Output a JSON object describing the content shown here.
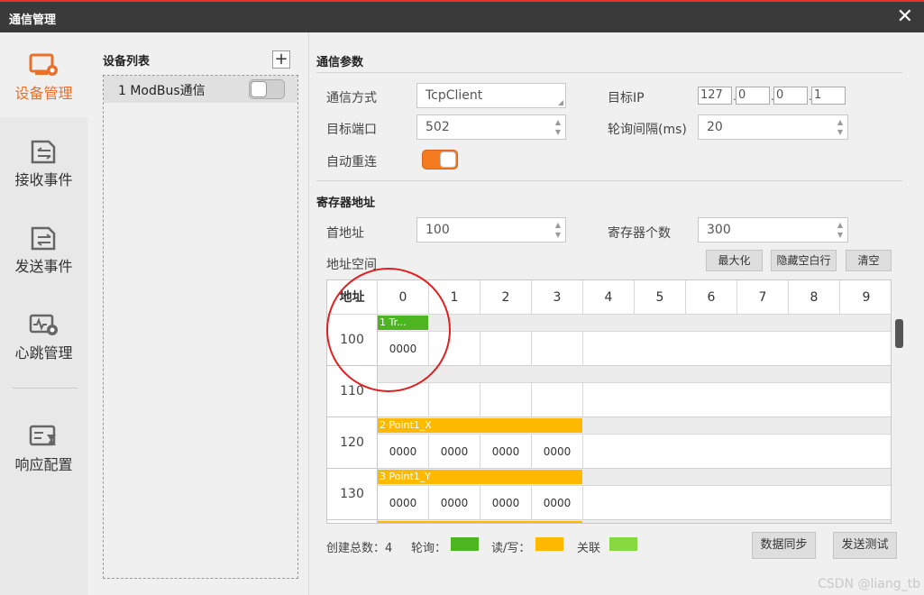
{
  "window": {
    "title": "通信管理",
    "close_glyph": "✕"
  },
  "nav": {
    "items": [
      {
        "label": "设备管理",
        "icon": "device-settings-icon",
        "active": true
      },
      {
        "label": "接收事件",
        "icon": "receive-event-icon"
      },
      {
        "label": "发送事件",
        "icon": "send-event-icon"
      },
      {
        "label": "心跳管理",
        "icon": "heartbeat-icon"
      },
      {
        "label": "响应配置",
        "icon": "response-config-icon"
      }
    ]
  },
  "devices": {
    "header": "设备列表",
    "add_glyph": "+",
    "items": [
      {
        "label": "1 ModBus通信",
        "enabled": false
      }
    ]
  },
  "comm": {
    "section_title": "通信参数",
    "mode_label": "通信方式",
    "mode_value": "TcpClient",
    "ip_label": "目标IP",
    "ip": [
      "127",
      "0",
      "0",
      "1"
    ],
    "ip_dot": ".",
    "port_label": "目标端口",
    "port_value": "502",
    "interval_label": "轮询间隔(ms)",
    "interval_value": "20",
    "reconnect_label": "自动重连",
    "reconnect_on": true,
    "spin_glyph": "▲\n▼"
  },
  "registers": {
    "section_title": "寄存器地址",
    "start_label": "首地址",
    "start_value": "100",
    "count_label": "寄存器个数",
    "count_value": "300",
    "space_label": "地址空间",
    "btn_maximize": "最大化",
    "btn_hide_empty": "隐藏空白行",
    "btn_clear": "清空",
    "grid": {
      "addr_header": "地址",
      "columns": [
        "0",
        "1",
        "2",
        "3",
        "4",
        "5",
        "6",
        "7",
        "8",
        "9"
      ],
      "rows": [
        {
          "addr": "100",
          "tag": {
            "label": "1 Tr...",
            "span": 1
          },
          "values": [
            "0000"
          ]
        },
        {
          "addr": "110",
          "tag": null,
          "values": []
        },
        {
          "addr": "120",
          "tag": {
            "label": "2 Point1_X",
            "span": 4
          },
          "values": [
            "0000",
            "0000",
            "0000",
            "0000"
          ]
        },
        {
          "addr": "130",
          "tag": {
            "label": "3 Point1_Y",
            "span": 4
          },
          "values": [
            "0000",
            "0000",
            "0000",
            "0000"
          ]
        }
      ]
    }
  },
  "footer": {
    "total_label": "创建总数：4",
    "poll_label": "轮询：",
    "rw_label": "读/写：",
    "link_label": "关联",
    "btn_sync": "数据同步",
    "btn_test": "发送测试"
  },
  "colors": {
    "poll": "#4cb520",
    "rw": "#ffba00",
    "link": "#88d840",
    "accent": "#e8702a",
    "highlight_circle": "#e02020"
  },
  "watermark": "CSDN @liang_tb"
}
